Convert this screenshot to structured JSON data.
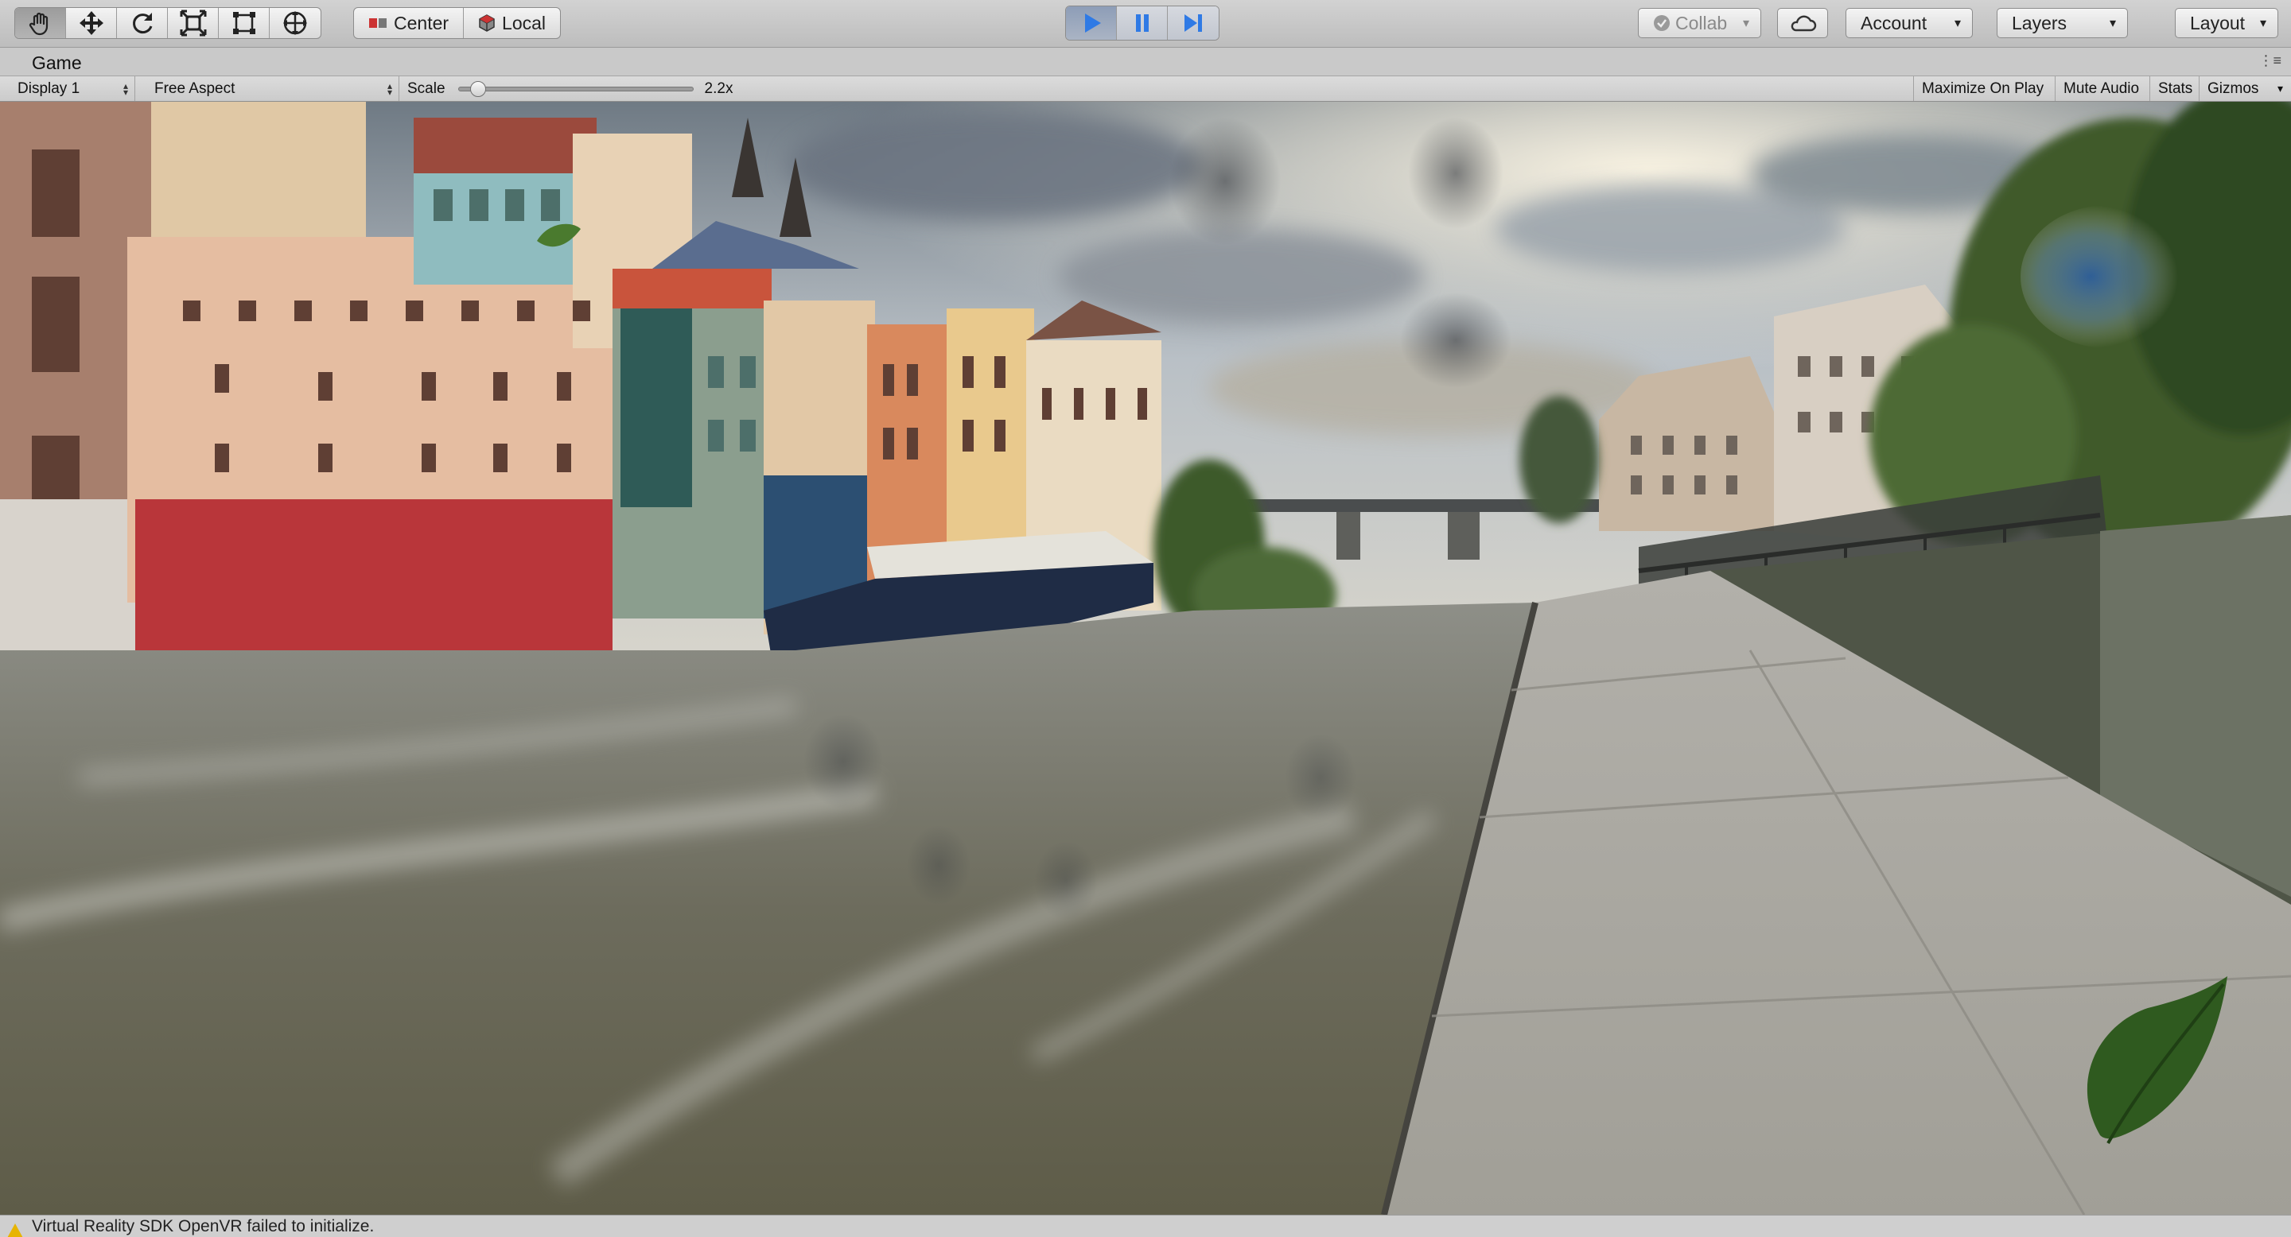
{
  "toolbar": {
    "tools": [
      "hand-icon",
      "move-icon",
      "rotate-icon",
      "scale-icon",
      "rect-icon",
      "transform-icon"
    ],
    "pivot_label": "Center",
    "space_label": "Local",
    "playback": [
      "play-icon",
      "pause-icon",
      "step-icon"
    ],
    "collab_label": "Collab",
    "account_label": "Account",
    "layers_label": "Layers",
    "layout_label": "Layout"
  },
  "tab": {
    "title": "Game"
  },
  "game_toolbar": {
    "display": "Display 1",
    "aspect": "Free Aspect",
    "scale_label": "Scale",
    "scale_value": "2.2x",
    "scale_fraction": 0.05,
    "maximize_label": "Maximize On Play",
    "mute_label": "Mute Audio",
    "stats_label": "Stats",
    "gizmos_label": "Gizmos"
  },
  "status": {
    "message": "Virtual Reality SDK OpenVR failed to initialize."
  },
  "colors": {
    "play_active": "#3b7ddd",
    "toolbar_bg": "#c8c8c8",
    "warning": "#e7b400"
  }
}
